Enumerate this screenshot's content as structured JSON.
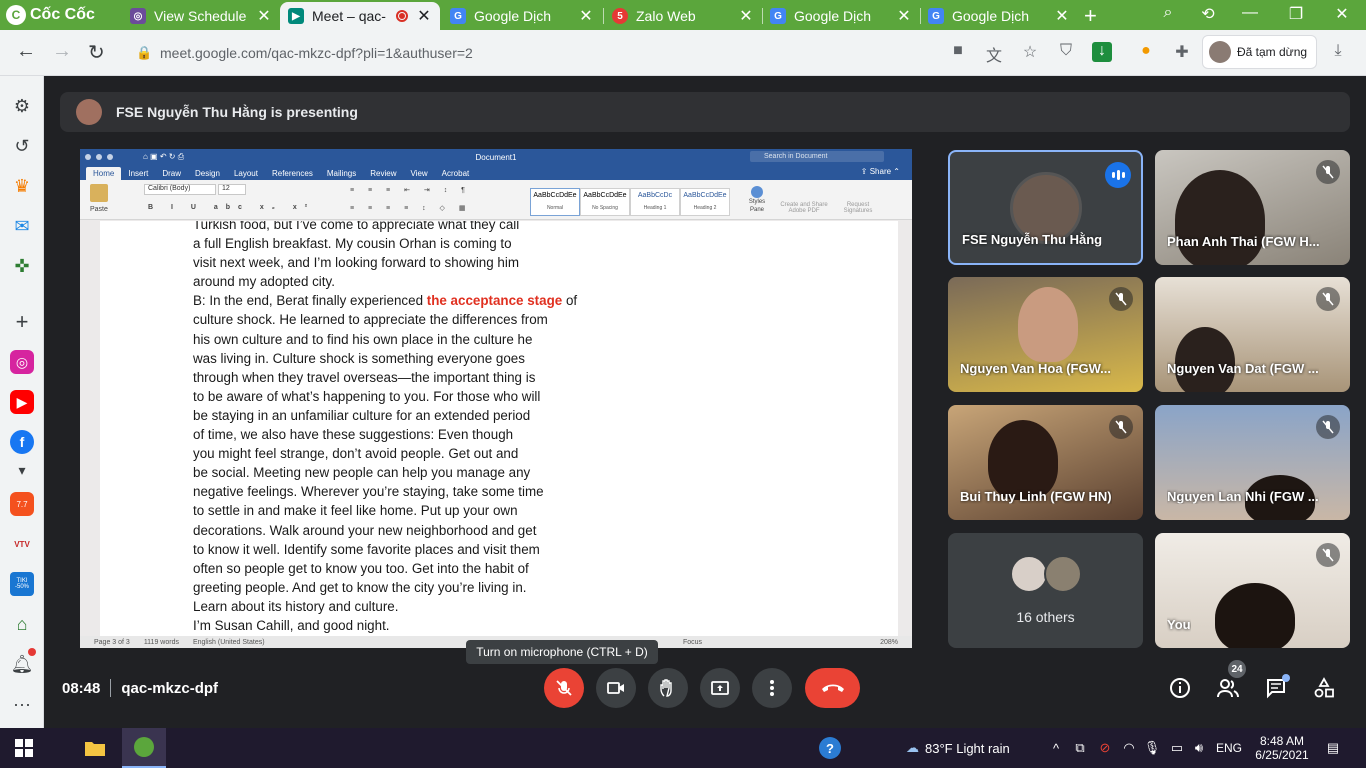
{
  "browser": {
    "brand": "Cốc Cốc",
    "tabs": [
      {
        "label": "View Schedule",
        "icon_color": "#6b4c9a"
      },
      {
        "label": "Meet – qac-",
        "icon_color": "#00897b"
      },
      {
        "label": "Google Dịch",
        "icon_color": "#4285f4"
      },
      {
        "label": "Zalo Web",
        "icon_color": "#e53935",
        "badge": "5"
      },
      {
        "label": "Google Dịch",
        "icon_color": "#4285f4"
      },
      {
        "label": "Google Dịch",
        "icon_color": "#4285f4"
      }
    ],
    "url": "meet.google.com/qac-mkzc-dpf?pli=1&authuser=2",
    "profile_label": "Đã tạm dừng"
  },
  "meet": {
    "presenting_banner": "FSE Nguyễn Thu Hằng is presenting",
    "participants": [
      {
        "name": "FSE Nguyễn Thu Hằng",
        "speaking": true
      },
      {
        "name": "Phan Anh Thai (FGW H...",
        "muted": true
      },
      {
        "name": "Nguyen Van Hoa (FGW...",
        "muted": true
      },
      {
        "name": "Nguyen Van Dat (FGW ...",
        "muted": true
      },
      {
        "name": "Bui Thuy Linh (FGW HN)",
        "muted": true
      },
      {
        "name": "Nguyen Lan Nhi (FGW ...",
        "muted": true
      },
      {
        "name": "16 others"
      },
      {
        "name": "You",
        "muted": true
      }
    ],
    "tooltip": "Turn on microphone (CTRL + D)",
    "time": "08:48",
    "meeting_code": "qac-mkzc-dpf",
    "participant_count": "24"
  },
  "word": {
    "doc_title": "Document1",
    "search_placeholder": "Search in Document",
    "share": "Share",
    "menu": [
      "Home",
      "Insert",
      "Draw",
      "Design",
      "Layout",
      "References",
      "Mailings",
      "Review",
      "View",
      "Acrobat"
    ],
    "font_name": "Calibri (Body)",
    "font_size": "12",
    "paste": "Paste",
    "styles": [
      {
        "preview": "AaBbCcDdEe",
        "name": "Normal"
      },
      {
        "preview": "AaBbCcDdEe",
        "name": "No Spacing"
      },
      {
        "preview": "AaBbCcDc",
        "name": "Heading 1"
      },
      {
        "preview": "AaBbCcDdEe",
        "name": "Heading 2"
      }
    ],
    "styles_pane": "Styles Pane",
    "create_pdf": "Create and Share Adobe PDF",
    "request_sig": "Request Signatures",
    "body_lines": [
      "Turkish food, but I’ve come to appreciate what they call",
      "a full English breakfast. My cousin Orhan is coming to",
      "visit next week, and I’m looking forward to showing him",
      "around my adopted city."
    ],
    "b_prefix": "B: In the end, Berat finally experienced ",
    "b_highlight": "the acceptance stage",
    "b_suffix": " of",
    "body_lines_2": [
      "culture shock. He learned to appreciate the differences from",
      "his own culture and to find his own place in the culture he",
      "was living in. Culture shock is something everyone goes",
      "through when they travel overseas—the important thing is",
      "to be aware of what’s happening to you. For those who will",
      "be staying in an unfamiliar culture for an extended period",
      "of time, we also have these suggestions: Even though",
      "you might feel strange, don’t avoid people. Get out and",
      "be social. Meeting new people can help you manage any",
      "negative feelings. Wherever you’re staying, take some time",
      "to settle in and make it feel like home. Put up your own",
      "decorations. Walk around your new neighborhood and get",
      "to know it well. Identify some favorite places and visit them",
      "often so people get to know you too. Get into the habit of",
      "greeting people. And get to know the city you’re living in.",
      "Learn about its history and culture.",
      "I’m Susan Cahill, and good night."
    ],
    "status": {
      "page": "Page 3 of 3",
      "words": "1119 words",
      "lang": "English (United States)",
      "focus": "Focus",
      "zoom": "208%"
    }
  },
  "taskbar": {
    "weather": "83°F  Light rain",
    "lang": "ENG",
    "time": "8:48 AM",
    "date": "6/25/2021"
  },
  "sidebar_badges": {
    "shop": "7.7",
    "tiki": "TIKI -50%",
    "vtv": "VTV"
  }
}
